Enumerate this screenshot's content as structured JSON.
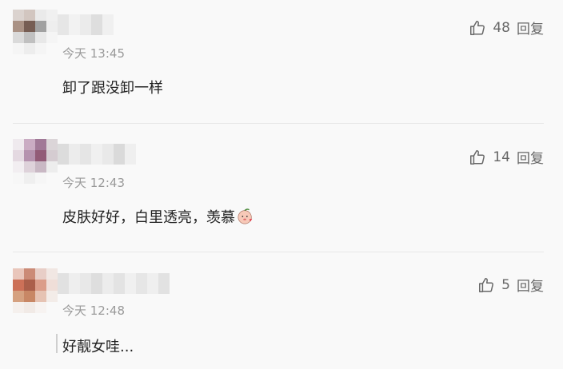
{
  "comments": [
    {
      "time": "今天 13:45",
      "text": "卸了跟没卸一样",
      "likes": "48",
      "reply_label": "回复",
      "avatar_colors": [
        "#d9d0cc",
        "#cfc2bc",
        "#e9e9e9",
        "#f0f0f0",
        "#a48a7c",
        "#6b5046",
        "#9a9a9a",
        "#eeeeee",
        "#d8d8d8",
        "#bcbcbc",
        "#e7e7e7",
        "#f5f5f5",
        "#f5f5f5",
        "#ececec",
        "#f5f5f5",
        "#f9f9f9"
      ],
      "username_colors": [
        "#e6e6e6",
        "#f2f2f2",
        "#ebebeb",
        "#dedede",
        "#f0f0f0"
      ]
    },
    {
      "time": "今天 12:43",
      "text": "皮肤好好，白里透亮，羡慕",
      "likes": "14",
      "reply_label": "回复",
      "emoji": "peach-face-emoji",
      "avatar_colors": [
        "#efe9ee",
        "#c7a6bf",
        "#9a6f8f",
        "#d9d2d6",
        "#e3d7e0",
        "#b08aa8",
        "#8a4e6d",
        "#d3c9ce",
        "#f2eef1",
        "#dccfd8",
        "#c6b3c0",
        "#ececec",
        "#f7f7f7",
        "#efefef",
        "#f6f6f6",
        "#f9f9f9"
      ],
      "username_colors": [
        "#dcdcdc",
        "#ececec",
        "#e5e5e5",
        "#f0f0f0",
        "#e9e9e9",
        "#dadada",
        "#efefef"
      ]
    },
    {
      "time": "今天 12:48",
      "text": "好靓女哇...",
      "likes": "5",
      "reply_label": "回复",
      "avatar_colors": [
        "#e8c2b6",
        "#c8826d",
        "#e7cbc3",
        "#f1e6e2",
        "#c9664b",
        "#a5523c",
        "#d99680",
        "#efdcd6",
        "#d39a76",
        "#c47e59",
        "#e5bfae",
        "#f3ebe7",
        "#f5f0ed",
        "#f1e9e5",
        "#f7f3f1",
        "#f9f9f9"
      ],
      "username_colors": [
        "#e1e1e1",
        "#eeeeee",
        "#e8e8e8",
        "#dedede",
        "#ececec",
        "#e3e3e3",
        "#f0f0f0",
        "#e6e6e6",
        "#efefef",
        "#e2e2e2"
      ]
    }
  ]
}
